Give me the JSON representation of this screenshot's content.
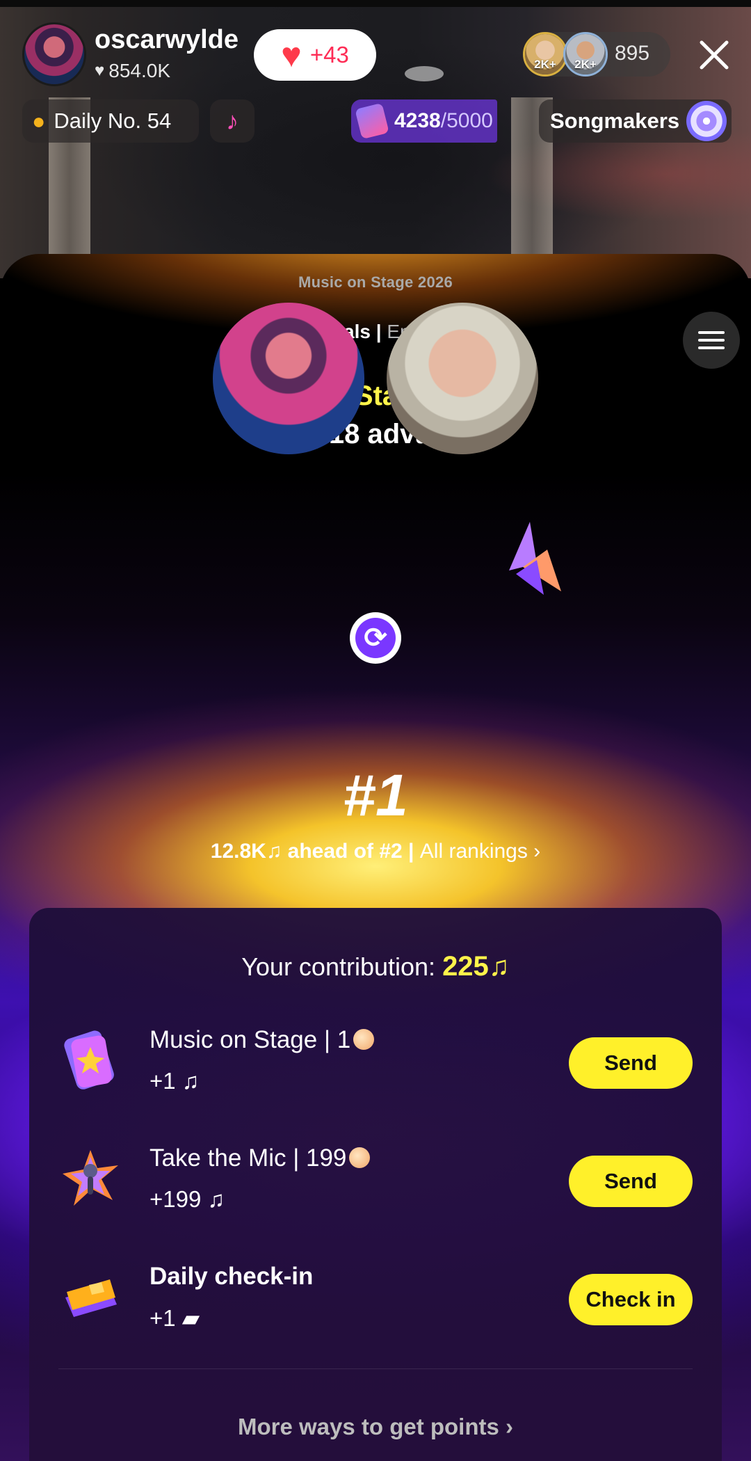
{
  "host": {
    "name": "oscarwylde",
    "likes": "854.0K"
  },
  "like_pill": {
    "count": "+43"
  },
  "viewers": {
    "levels": [
      "2K+",
      "2K+"
    ],
    "count": "895"
  },
  "chips": {
    "daily": "Daily No. 54",
    "goal_current": "4238",
    "goal_max": "/5000",
    "songmakers": "Songmakers"
  },
  "panel": {
    "event": "Music on Stage 2026",
    "round": "US Semi-finals",
    "separator": " | ",
    "ends": "Ends in 1 day",
    "category": "Super Stars | DJ",
    "advance": "Top 18 advance",
    "rank": "#1",
    "ahead": "12.8K♫ ahead of #2",
    "all_rankings": "All rankings"
  },
  "contribution": {
    "label": "Your contribution: ",
    "value": "225♫",
    "tasks": [
      {
        "title": "Music on Stage | 1",
        "sub": "+1 ♫",
        "button": "Send"
      },
      {
        "title": "Take the Mic | 199",
        "sub": "+199 ♫",
        "button": "Send"
      },
      {
        "title": "Daily check-in",
        "sub": "+1",
        "button": "Check in"
      }
    ],
    "more": "More ways to get points"
  },
  "colors": {
    "accent_yellow": "#fff02a",
    "brand_purple": "#7a37ff",
    "like_red": "#fe2c55"
  }
}
